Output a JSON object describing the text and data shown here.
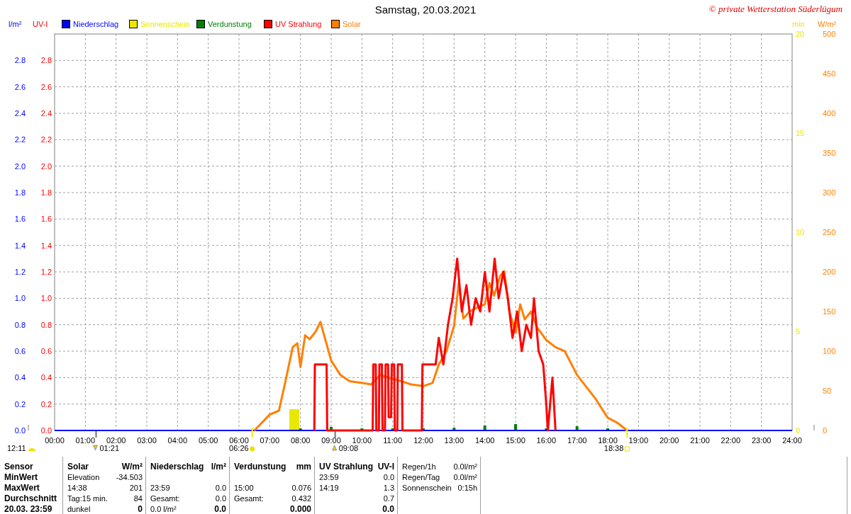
{
  "title": "Samstag, 20.03.2021",
  "copyright": "© private Wetterstation Süderlügum",
  "units": {
    "left_outer": "l/m²",
    "left_inner": "UV-I",
    "right_inner": "min",
    "right_outer": "W/m²"
  },
  "legend": [
    {
      "label": "Niederschlag",
      "color": "#0000ff"
    },
    {
      "label": "Sonnenschein",
      "color": "#e8e800"
    },
    {
      "label": "Verdunstung",
      "color": "#008000"
    },
    {
      "label": "UV Strahlung",
      "color": "#ff0000"
    },
    {
      "label": "Solar",
      "color": "#ff8000"
    }
  ],
  "axes": {
    "uv": [
      "2.8",
      "2.6",
      "2.4",
      "2.2",
      "2.0",
      "1.8",
      "1.6",
      "1.4",
      "1.2",
      "1.0",
      "0.8",
      "0.6",
      "0.4",
      "0.2",
      "0.0"
    ],
    "min": [
      "20",
      "15",
      "10",
      "5",
      "0"
    ]
  },
  "chart": {
    "chart_data": {
      "type": "line",
      "grid": true,
      "xlim": [
        0,
        24
      ],
      "ylim": [
        0,
        3
      ],
      "y2lim": [
        0,
        500
      ],
      "y2ticks": [
        0,
        50,
        100,
        150,
        200,
        250,
        300,
        350,
        400,
        450,
        500
      ],
      "xticks": [
        {
          "value": 0,
          "label": "00:00"
        },
        {
          "value": 1,
          "label": "01:00"
        },
        {
          "value": 2,
          "label": "02:00"
        },
        {
          "value": 3,
          "label": "03:00"
        },
        {
          "value": 4,
          "label": "04:00"
        },
        {
          "value": 5,
          "label": "05:00"
        },
        {
          "value": 6,
          "label": "06:00"
        },
        {
          "value": 7,
          "label": "07:00"
        },
        {
          "value": 8,
          "label": "08:00"
        },
        {
          "value": 9,
          "label": "09:00"
        },
        {
          "value": 10,
          "label": "10:00"
        },
        {
          "value": 11,
          "label": "11:00"
        },
        {
          "value": 12,
          "label": "12:00"
        },
        {
          "value": 13,
          "label": "13:00"
        },
        {
          "value": 14,
          "label": "14:00"
        },
        {
          "value": 15,
          "label": "15:00"
        },
        {
          "value": 16,
          "label": "16:00"
        },
        {
          "value": 17,
          "label": "17:00"
        },
        {
          "value": 18,
          "label": "18:00"
        },
        {
          "value": 19,
          "label": "19:00"
        },
        {
          "value": 20,
          "label": "20:00"
        },
        {
          "value": 21,
          "label": "21:00"
        },
        {
          "value": 22,
          "label": "22:00"
        },
        {
          "value": 23,
          "label": "23:00"
        },
        {
          "value": 24,
          "label": "24:00"
        }
      ],
      "yticks": [
        {
          "value": 0,
          "label": "0.0"
        },
        {
          "value": 0.2,
          "label": "0.2"
        },
        {
          "value": 0.4,
          "label": "0.4"
        },
        {
          "value": 0.6,
          "label": "0.6"
        },
        {
          "value": 0.8,
          "label": "0.8"
        },
        {
          "value": 1,
          "label": "1.0"
        },
        {
          "value": 1.2,
          "label": "1.2"
        },
        {
          "value": 1.4,
          "label": "1.4"
        },
        {
          "value": 1.6,
          "label": "1.6"
        },
        {
          "value": 1.8,
          "label": "1.8"
        },
        {
          "value": 2,
          "label": "2.0"
        },
        {
          "value": 2.2,
          "label": "2.2"
        },
        {
          "value": 2.4,
          "label": "2.4"
        },
        {
          "value": 2.6,
          "label": "2.6"
        },
        {
          "value": 2.8,
          "label": "2.8"
        }
      ],
      "series": [
        {
          "color": "#0000ff",
          "x": [
            0,
            24
          ],
          "values": [
            0,
            0
          ]
        },
        {
          "color": "#ff8000",
          "axis": "y2",
          "x": [
            6.5,
            7,
            7.3,
            7.5,
            7.75,
            7.9,
            8,
            8.15,
            8.3,
            8.5,
            8.65,
            9,
            9.3,
            9.6,
            10,
            10.3,
            10.6,
            11,
            11.3,
            11.6,
            12,
            12.3,
            12.5,
            12.75,
            13,
            13.15,
            13.3,
            13.5,
            13.75,
            14,
            14.15,
            14.3,
            14.5,
            14.63,
            14.8,
            15,
            15.15,
            15.3,
            15.5,
            15.7,
            16,
            16.3,
            16.6,
            17,
            17.3,
            17.6,
            18,
            18.3,
            18.63
          ],
          "values": [
            0,
            20,
            25,
            60,
            105,
            110,
            80,
            120,
            115,
            125,
            137,
            88,
            70,
            62,
            60,
            58,
            70,
            65,
            62,
            58,
            56,
            60,
            83,
            100,
            132,
            186,
            141,
            150,
            155,
            159,
            186,
            170,
            195,
            201,
            150,
            123,
            159,
            140,
            150,
            130,
            114,
            105,
            100,
            70,
            55,
            40,
            16,
            10,
            0
          ]
        },
        {
          "color": "#ff0000",
          "x": [
            8.45,
            8.47,
            8.85,
            8.87,
            10.35,
            10.37,
            10.45,
            10.47,
            10.55,
            10.57,
            10.65,
            10.67,
            10.75,
            10.77,
            10.85,
            10.87,
            10.95,
            10.97,
            11.05,
            11.07,
            11.15,
            11.17,
            11.3,
            11.32,
            11.95,
            11.97,
            12.4,
            12.5,
            12.65,
            12.8,
            12.95,
            13.1,
            13.25,
            13.4,
            13.55,
            13.7,
            13.85,
            14,
            14.15,
            14.32,
            14.45,
            14.6,
            14.75,
            14.9,
            15.05,
            15.2,
            15.35,
            15.5,
            15.6,
            15.75,
            15.9,
            16,
            16.05,
            16.2,
            16.3
          ],
          "values": [
            0,
            0.5,
            0.5,
            0,
            0,
            0.5,
            0.5,
            0,
            0,
            0.5,
            0.5,
            0,
            0,
            0.5,
            0.5,
            0.1,
            0.1,
            0.5,
            0.5,
            0,
            0,
            0.5,
            0.5,
            0,
            0,
            0.5,
            0.5,
            0.7,
            0.5,
            0.8,
            1.0,
            1.3,
            0.9,
            1.1,
            0.8,
            1.0,
            0.9,
            1.2,
            0.9,
            1.3,
            1.0,
            1.2,
            1.0,
            0.7,
            0.9,
            0.6,
            0.8,
            0.7,
            1.0,
            0.6,
            0.5,
            0.2,
            0,
            0.4,
            0
          ]
        }
      ]
    }
  },
  "astro_events": [
    {
      "kind": "daylength",
      "time": "12:11"
    },
    {
      "kind": "moonset",
      "time": "01:21"
    },
    {
      "kind": "sunrise",
      "time": "06:26"
    },
    {
      "kind": "moonrise",
      "time": "09:08"
    },
    {
      "kind": "sunset",
      "time": "18:38"
    }
  ],
  "table": {
    "sections": [
      {
        "kind": "labels",
        "rows": [
          "Sensor",
          "MinWert",
          "MaxWert",
          "Durchschnitt",
          "20.03. 23:59"
        ]
      },
      {
        "kind": "pairs",
        "header": "Solar",
        "unit": "W/m²",
        "rows": [
          {
            "label": "Elevation",
            "value": "-34.503"
          },
          {
            "label": "14:38",
            "value": "201"
          },
          {
            "label": "Tag:15 min.",
            "value": "84"
          },
          {
            "label": "dunkel",
            "value": "0"
          }
        ]
      },
      {
        "kind": "pairs",
        "header": "Niederschlag",
        "unit": "l/m²",
        "rows": [
          {},
          {
            "label": "23:59",
            "value": "0.0"
          },
          {
            "label": "Gesamt:",
            "value": "0.0"
          },
          {
            "label": "0.0 l/m²",
            "value": "0.0"
          }
        ]
      },
      {
        "kind": "pairs",
        "header": "Verdunstung",
        "unit": "mm",
        "rows": [
          {},
          {
            "label": "15:00",
            "value": "0.076"
          },
          {
            "label": "Gesamt:",
            "value": "0.432"
          },
          {
            "value": "0.000"
          }
        ]
      },
      {
        "kind": "pairs",
        "header": "UV Strahlung",
        "unit": "UV-I",
        "rows": [
          {
            "label": "23:59",
            "value": "0.0"
          },
          {
            "label": "14:19",
            "value": "1.3"
          },
          {
            "value": "0.7"
          },
          {
            "value": "0.0"
          }
        ]
      },
      {
        "kind": "plain",
        "rows": [
          {
            "label": "Regen/1h",
            "value": "0.0l/m²"
          },
          {
            "label": "Regen/Tag",
            "value": "0.0l/m²"
          },
          {
            "label": "Sonnenschein",
            "value": "0:15h"
          }
        ]
      }
    ]
  }
}
